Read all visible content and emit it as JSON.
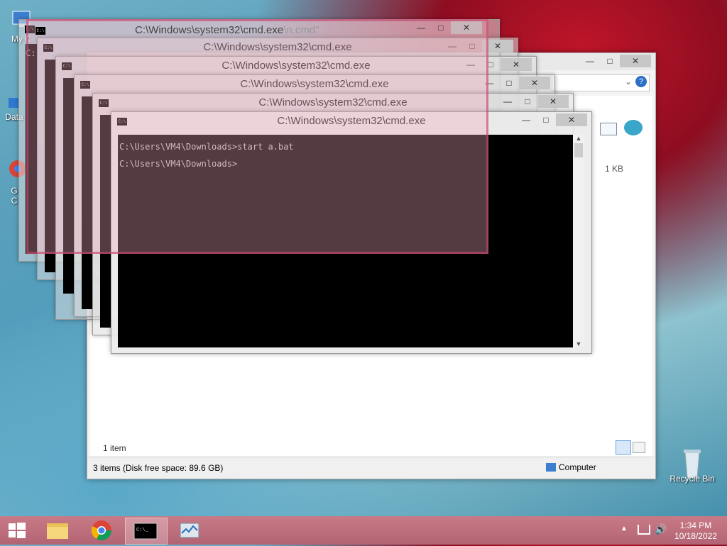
{
  "desktop": {
    "icons": [
      {
        "label": "My C"
      },
      {
        "label": "Data"
      },
      {
        "label": "G"
      },
      {
        "label": "C"
      },
      {
        "label": "Recycle Bin"
      }
    ]
  },
  "explorer": {
    "status_items": "1 item",
    "file_size": "1 KB",
    "status_bar": "3 items (Disk free space: 89.6 GB)",
    "location": "Computer"
  },
  "ghost_window": {
    "title": "C:\\Windows\\system32\\cmd.exe",
    "title_suffix": "\\n.cmd\""
  },
  "cmd_windows": [
    {
      "title": "C:\\Windows\\system32\\cmd.exe"
    },
    {
      "title": "C:\\Windows\\system32\\cmd.exe"
    },
    {
      "title": "C:\\Windows\\system32\\cmd.exe"
    },
    {
      "title": "C:\\Windows\\system32\\cmd.exe"
    },
    {
      "title": "C:\\Windows\\system32\\cmd.exe"
    },
    {
      "title": "C:\\Windows\\system32\\cmd.exe"
    }
  ],
  "console": {
    "line1": "C:\\Users\\VM4\\Downloads>start a.bat",
    "line2": "C:\\Users\\VM4\\Downloads>",
    "prompt_fragment": "C:"
  },
  "taskbar": {
    "time": "1:34 PM",
    "date": "10/18/2022"
  },
  "colors": {
    "taskbar": "#b36474",
    "console_bg": "#000000",
    "console_fg": "#c0c0c0"
  }
}
